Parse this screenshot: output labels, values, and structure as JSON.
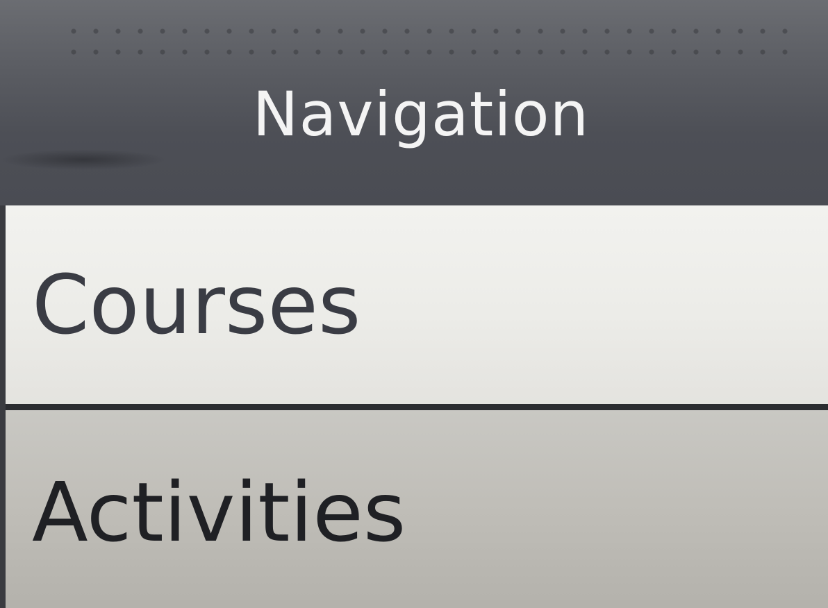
{
  "header": {
    "title": "Navigation"
  },
  "menu": {
    "items": [
      {
        "label": "Courses"
      },
      {
        "label": "Activities"
      }
    ]
  },
  "colors": {
    "header_background": "#4d4f56",
    "header_text": "#f4f4f4",
    "item_background_top": "#ecece8",
    "item_background_bottom": "#bfbdb7",
    "divider": "#2b2c30",
    "item_text": "#3a3c44"
  }
}
